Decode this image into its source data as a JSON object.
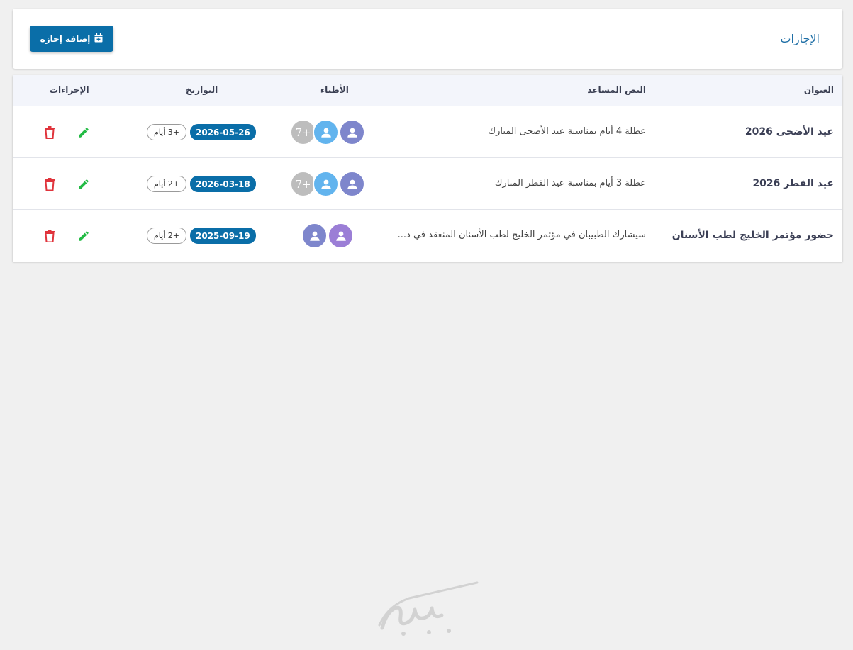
{
  "header": {
    "title": "الإجازات",
    "add_button_label": "إضافة إجازة",
    "add_button_icon": "calendar-plus-icon"
  },
  "table": {
    "columns": {
      "title": "العنوان",
      "help_text": "النص المساعد",
      "doctors": "الأطباء",
      "dates": "التواريخ",
      "actions": "الإجراءات"
    },
    "rows": [
      {
        "title": "عيد الأضحى 2026",
        "help_text": "عطلة 4 أيام بمناسبة عيد الأضحى المبارك",
        "avatars": [
          "user",
          "user",
          "count"
        ],
        "avatar_colors": [
          "#7e86cc",
          "#62b4ee",
          "#bdbdbd"
        ],
        "more_count": "7+",
        "start_date": "2026-05-26",
        "extra_days": "+3 أيام"
      },
      {
        "title": "عيد الفطر 2026",
        "help_text": "عطلة 3 أيام بمناسبة عيد الفطر المبارك",
        "avatars": [
          "user",
          "user",
          "count"
        ],
        "avatar_colors": [
          "#7e86cc",
          "#62b4ee",
          "#bdbdbd"
        ],
        "more_count": "7+",
        "start_date": "2026-03-18",
        "extra_days": "+2 أيام"
      },
      {
        "title": "حضور مؤتمر الخليج لطب الأسنان",
        "help_text": "سيشارك الطبيبان في مؤتمر الخليج لطب الأسنان المنعقد في د...",
        "avatars": [
          "user",
          "user"
        ],
        "avatar_colors": [
          "#9b7ed6",
          "#7e86cc"
        ],
        "more_count": "",
        "start_date": "2025-09-19",
        "extra_days": "+2 أيام"
      }
    ]
  },
  "icons": {
    "edit": "pencil-icon",
    "delete": "trash-icon",
    "avatar": "user-icon"
  },
  "colors": {
    "primary": "#0a6ea8",
    "edit": "#22bb44",
    "delete": "#e0343c",
    "title_link": "#1f6fa6"
  },
  "footer_logo": "بيانيتا"
}
